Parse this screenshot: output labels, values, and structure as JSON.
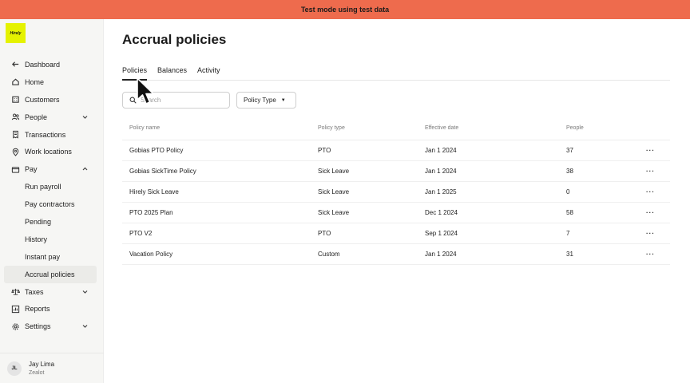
{
  "banner": {
    "text": "Test mode using test data"
  },
  "logo": {
    "text": "Hirely"
  },
  "sidebar": {
    "items": [
      {
        "label": "Dashboard",
        "icon": "arrow-left-icon",
        "level": 0
      },
      {
        "label": "Home",
        "icon": "home-icon",
        "level": 0
      },
      {
        "label": "Customers",
        "icon": "building-icon",
        "level": 0
      },
      {
        "label": "People",
        "icon": "people-icon",
        "level": 0,
        "chevron": "down"
      },
      {
        "label": "Transactions",
        "icon": "receipt-icon",
        "level": 0
      },
      {
        "label": "Work locations",
        "icon": "location-pin-icon",
        "level": 0
      },
      {
        "label": "Pay",
        "icon": "wallet-icon",
        "level": 0,
        "chevron": "up"
      },
      {
        "label": "Run payroll",
        "level": 1
      },
      {
        "label": "Pay contractors",
        "level": 1
      },
      {
        "label": "Pending",
        "level": 1
      },
      {
        "label": "History",
        "level": 1
      },
      {
        "label": "Instant pay",
        "level": 1
      },
      {
        "label": "Accrual policies",
        "level": 1,
        "active": true
      },
      {
        "label": "Taxes",
        "icon": "scale-icon",
        "level": 0,
        "chevron": "down"
      },
      {
        "label": "Reports",
        "icon": "chart-icon",
        "level": 0
      },
      {
        "label": "Settings",
        "icon": "gear-icon",
        "level": 0,
        "chevron": "down"
      }
    ],
    "user": {
      "initials": "JL",
      "name": "Jay Lima",
      "org": "Zealot"
    }
  },
  "main": {
    "title": "Accrual policies",
    "tabs": [
      {
        "label": "Policies",
        "active": true
      },
      {
        "label": "Balances"
      },
      {
        "label": "Activity"
      }
    ],
    "search": {
      "placeholder": "Search",
      "value": ""
    },
    "filter": {
      "label": "Policy Type"
    }
  },
  "table": {
    "headers": [
      "Policy name",
      "Policy type",
      "Effective date",
      "People"
    ],
    "rows": [
      {
        "name": "Gobias PTO Policy",
        "type": "PTO",
        "date": "Jan 1 2024",
        "people": "37"
      },
      {
        "name": "Gobias SickTime Policy",
        "type": "Sick Leave",
        "date": "Jan 1 2024",
        "people": "38"
      },
      {
        "name": "Hirely Sick Leave",
        "type": "Sick Leave",
        "date": "Jan 1 2025",
        "people": "0"
      },
      {
        "name": "PTO 2025 Plan",
        "type": "Sick Leave",
        "date": "Dec 1 2024",
        "people": "58"
      },
      {
        "name": "PTO V2",
        "type": "PTO",
        "date": "Sep 1 2024",
        "people": "7"
      },
      {
        "name": "Vacation Policy",
        "type": "Custom",
        "date": "Jan 1 2024",
        "people": "31"
      }
    ],
    "row_menu_label": "···"
  },
  "colors": {
    "banner": "#ee6b4d",
    "logo": "#e5f200",
    "sidebar_bg": "#f6f6f4",
    "active_item": "#ebebe8"
  }
}
